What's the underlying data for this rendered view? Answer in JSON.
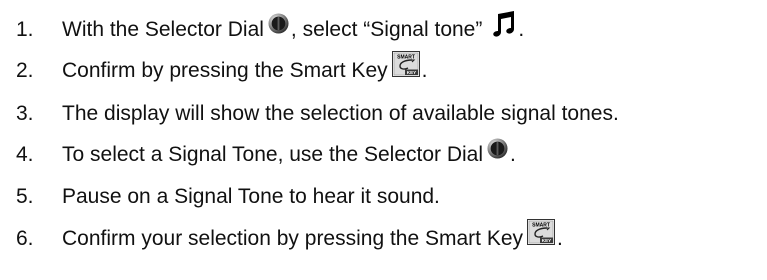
{
  "steps": [
    {
      "number": "1.",
      "text_a": "With the Selector Dial",
      "icon_a": "selector-dial-icon",
      "text_b": ", select “Signal tone”",
      "icon_b": "music-note-icon",
      "text_c": "."
    },
    {
      "number": "2.",
      "text_a": "Confirm by pressing the Smart Key",
      "icon_a": "smart-key-icon",
      "text_b": "."
    },
    {
      "number": "3.",
      "text_a": "The display will show the selection of available signal tones."
    },
    {
      "number": "4.",
      "text_a": "To select a Signal Tone, use the Selector Dial",
      "icon_a": "selector-dial-icon",
      "text_b": "."
    },
    {
      "number": "5.",
      "text_a": "Pause on a Signal Tone to hear it sound."
    },
    {
      "number": "6.",
      "text_a": "Confirm your selection by pressing the Smart Key",
      "icon_a": "smart-key-icon",
      "text_b": "."
    }
  ],
  "smart_key_label": {
    "top": "SMART",
    "bottom": "KEY"
  }
}
